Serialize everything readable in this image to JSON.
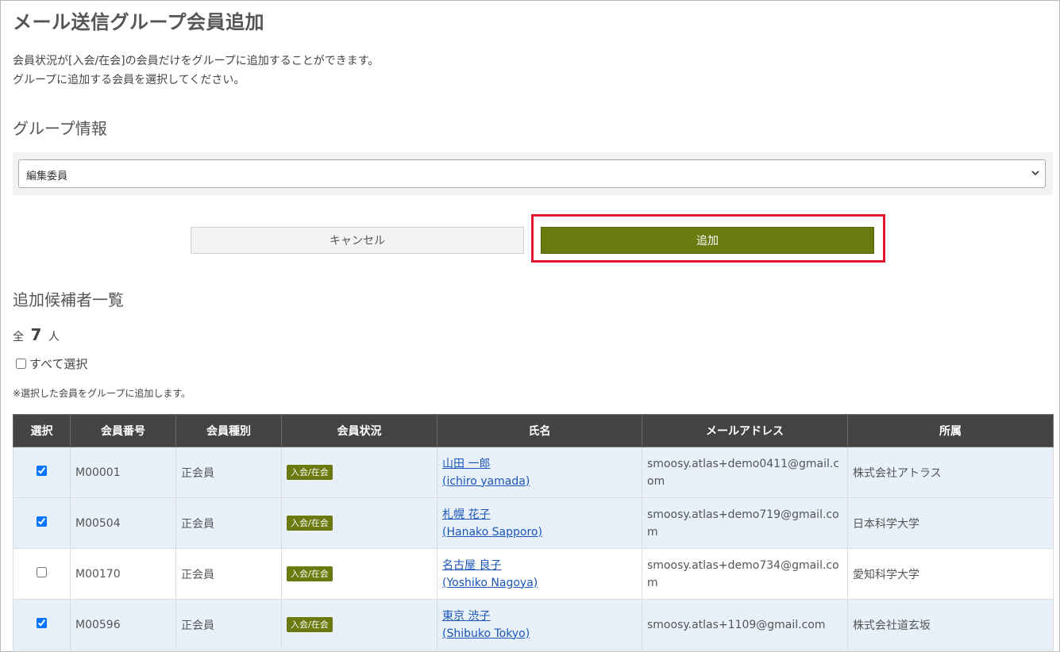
{
  "page": {
    "title": "メール送信グループ会員追加",
    "desc_line1": "会員状況が[入会/在会]の会員だけをグループに追加することができます。",
    "desc_line2": "グループに追加する会員を選択してください。"
  },
  "group_section": {
    "title": "グループ情報",
    "select_value": "編集委員"
  },
  "buttons": {
    "cancel": "キャンセル",
    "add": "追加"
  },
  "candidates": {
    "title": "追加候補者一覧",
    "count_prefix": "全",
    "count_value": "7",
    "count_suffix": "人",
    "select_all": "すべて選択",
    "note": "※選択した会員をグループに追加します。"
  },
  "table": {
    "headers": [
      "選択",
      "会員番号",
      "会員種別",
      "会員状況",
      "氏名",
      "メールアドレス",
      "所属"
    ],
    "rows": [
      {
        "checked": true,
        "id": "M00001",
        "type": "正会員",
        "status": "入会/在会",
        "name_ja": "山田 一郎",
        "name_en": "(ichiro yamada)",
        "email": "smoosy.atlas+demo0411@gmail.com",
        "org": "株式会社アトラス"
      },
      {
        "checked": true,
        "id": "M00504",
        "type": "正会員",
        "status": "入会/在会",
        "name_ja": "札幌 花子",
        "name_en": "(Hanako Sapporo)",
        "email": "smoosy.atlas+demo719@gmail.com",
        "org": "日本科学大学"
      },
      {
        "checked": false,
        "id": "M00170",
        "type": "正会員",
        "status": "入会/在会",
        "name_ja": "名古屋 良子",
        "name_en": "(Yoshiko Nagoya)",
        "email": "smoosy.atlas+demo734@gmail.com",
        "org": "愛知科学大学"
      },
      {
        "checked": true,
        "id": "M00596",
        "type": "正会員",
        "status": "入会/在会",
        "name_ja": "東京 渋子",
        "name_en": "(Shibuko Tokyo)",
        "email": "smoosy.atlas+1109@gmail.com",
        "org": "株式会社道玄坂"
      }
    ]
  },
  "colors": {
    "accent": "#6b7a0e",
    "highlight": "#e3162b",
    "header_bg": "#444444",
    "checked_row_bg": "#e8f1fa"
  },
  "icons": {
    "select_arrow": "chevron-down-icon"
  }
}
